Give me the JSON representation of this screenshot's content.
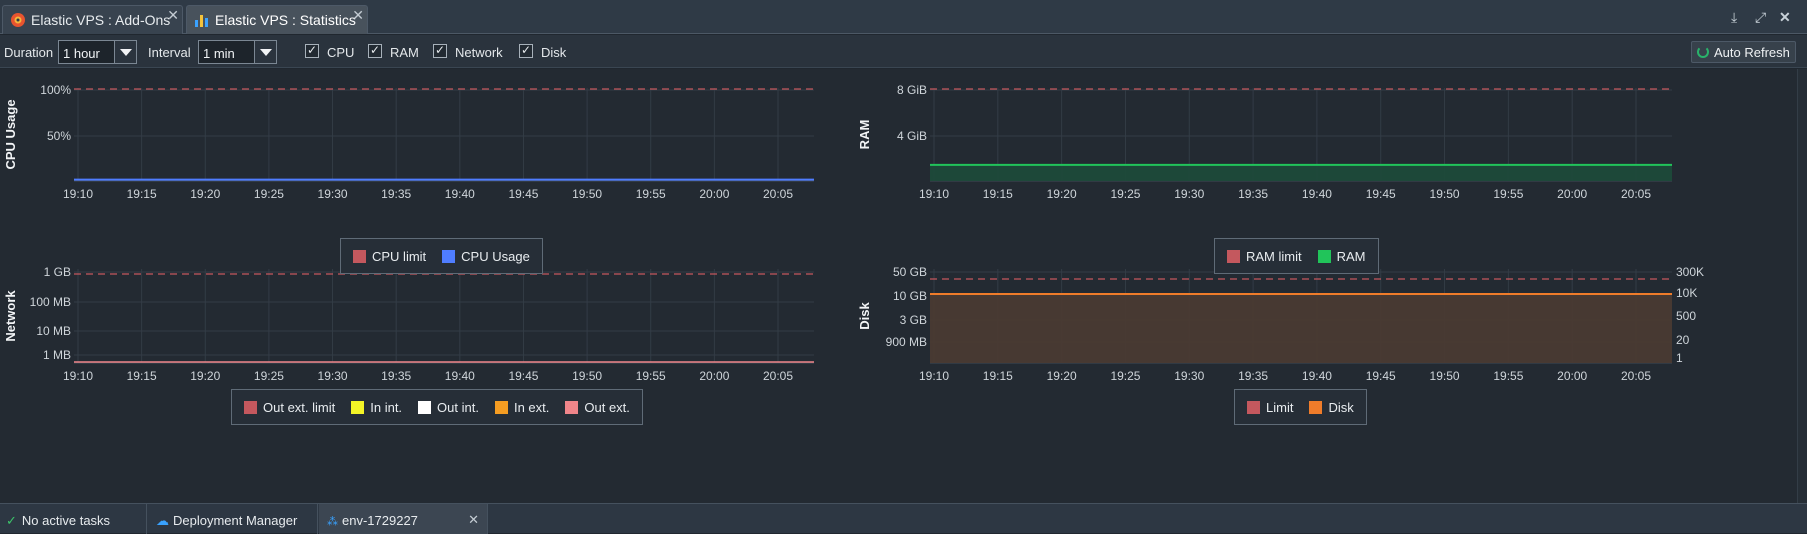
{
  "tabs": [
    {
      "label": "Elastic VPS : Add-Ons",
      "active": false
    },
    {
      "label": "Elastic VPS : Statistics",
      "active": true
    }
  ],
  "toolbar": {
    "duration_label": "Duration",
    "duration_value": "1 hour",
    "interval_label": "Interval",
    "interval_value": "1 min",
    "checks": [
      {
        "label": "CPU",
        "checked": true
      },
      {
        "label": "RAM",
        "checked": true
      },
      {
        "label": "Network",
        "checked": true
      },
      {
        "label": "Disk",
        "checked": true
      }
    ],
    "refresh_label": "Auto Refresh"
  },
  "colors": {
    "limit": "#c4585e",
    "cpu": "#4f7dff",
    "ram": "#21c45a",
    "disk": "#ef7c2a",
    "in_int": "#f4f427",
    "out_int": "#ffffff",
    "in_ext": "#f59d22",
    "out_ext": "#f0858a"
  },
  "chart_data": [
    {
      "type": "line",
      "ylabel": "CPU Usage",
      "y_ticks": [
        "100%",
        "50%"
      ],
      "x_ticks": [
        "19:10",
        "19:15",
        "19:20",
        "19:25",
        "19:30",
        "19:35",
        "19:40",
        "19:45",
        "19:50",
        "19:55",
        "20:00",
        "20:05"
      ],
      "limit": "100%",
      "series": [
        {
          "name": "CPU limit",
          "values": [
            100,
            100,
            100,
            100,
            100,
            100,
            100,
            100,
            100,
            100,
            100,
            100
          ]
        },
        {
          "name": "CPU Usage",
          "values": [
            1,
            1,
            1,
            1,
            1,
            1,
            1,
            1,
            1,
            1,
            1,
            1
          ]
        }
      ],
      "legend": [
        "CPU limit",
        "CPU Usage"
      ]
    },
    {
      "type": "area",
      "ylabel": "RAM",
      "y_ticks": [
        "8 GiB",
        "4 GiB"
      ],
      "x_ticks": [
        "19:10",
        "19:15",
        "19:20",
        "19:25",
        "19:30",
        "19:35",
        "19:40",
        "19:45",
        "19:50",
        "19:55",
        "20:00",
        "20:05"
      ],
      "series": [
        {
          "name": "RAM limit",
          "values": [
            8,
            8,
            8,
            8,
            8,
            8,
            8,
            8,
            8,
            8,
            8,
            8
          ]
        },
        {
          "name": "RAM",
          "values": [
            1.4,
            1.4,
            1.4,
            1.4,
            1.4,
            1.4,
            1.4,
            1.4,
            1.4,
            1.4,
            1.4,
            1.4
          ]
        }
      ],
      "legend": [
        "RAM limit",
        "RAM"
      ]
    },
    {
      "type": "line",
      "ylabel": "Network",
      "y_ticks": [
        "1 GB",
        "100 MB",
        "10 MB",
        "1 MB"
      ],
      "x_ticks": [
        "19:10",
        "19:15",
        "19:20",
        "19:25",
        "19:30",
        "19:35",
        "19:40",
        "19:45",
        "19:50",
        "19:55",
        "20:00",
        "20:05"
      ],
      "y_scale": "log",
      "series": [
        {
          "name": "Out ext. limit",
          "values": [
            "1 GB"
          ]
        },
        {
          "name": "In int.",
          "values": []
        },
        {
          "name": "Out int.",
          "values": []
        },
        {
          "name": "In ext.",
          "values": []
        },
        {
          "name": "Out ext.",
          "values": []
        }
      ],
      "legend": [
        "Out ext. limit",
        "In int.",
        "Out int.",
        "In ext.",
        "Out ext."
      ]
    },
    {
      "type": "area",
      "ylabel": "Disk",
      "y_ticks": [
        "50 GB",
        "10 GB",
        "3 GB",
        "900 MB"
      ],
      "y2_ticks": [
        "300K",
        "10K",
        "500",
        "20",
        "1"
      ],
      "x_ticks": [
        "19:10",
        "19:15",
        "19:20",
        "19:25",
        "19:30",
        "19:35",
        "19:40",
        "19:45",
        "19:50",
        "19:55",
        "20:00",
        "20:05"
      ],
      "y_scale": "log",
      "series": [
        {
          "name": "Limit",
          "values": [
            "50 GB"
          ]
        },
        {
          "name": "Disk",
          "values": [
            "10 GB"
          ]
        }
      ],
      "legend": [
        "Limit",
        "Disk"
      ]
    }
  ],
  "taskbar": {
    "status": "No active tasks",
    "deployment_manager": "Deployment Manager",
    "env_tab": "env-1729227"
  }
}
